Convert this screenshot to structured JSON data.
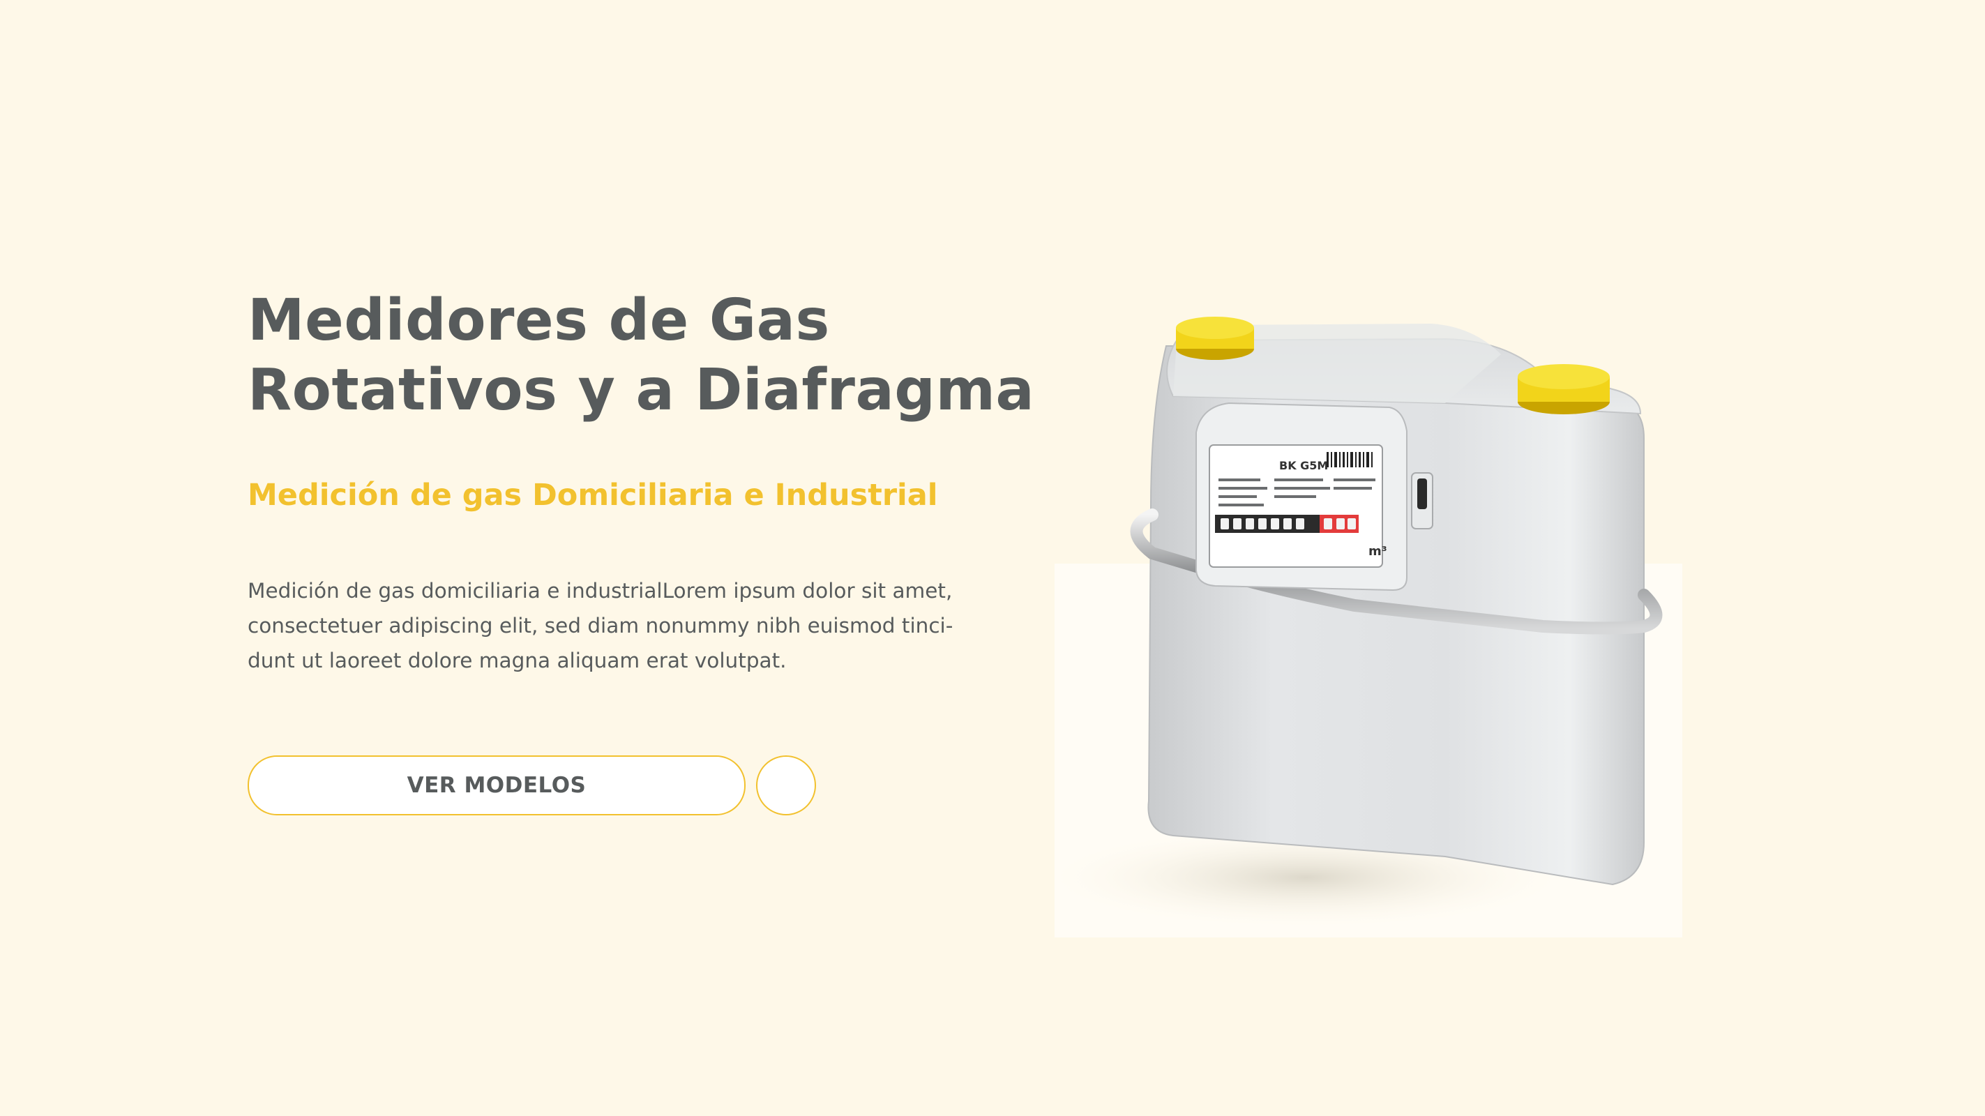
{
  "hero": {
    "title_lines": [
      "Medidores de Gas",
      "Rotativos y a Diafragma"
    ],
    "subtitle": "Medición de gas Domiciliaria  e Industrial",
    "description_lines": [
      "Medición de gas domiciliaria  e industrialLorem ipsum dolor sit amet,",
      "consectetuer adipiscing elit, sed diam nonummy nibh euismod tinci-",
      "dunt ut laoreet dolore magna aliquam erat volutpat."
    ],
    "cta_label": "VER MODELOS",
    "next_button_icon": "circle-button"
  },
  "product": {
    "label_model": "BK G5M",
    "counter_unit": "m³",
    "image_name": "gas-meter-diaphragm"
  },
  "colors": {
    "background": "#fef8e8",
    "heading": "#575b5c",
    "accent": "#f2c12e",
    "button_bg": "#ffffff"
  }
}
